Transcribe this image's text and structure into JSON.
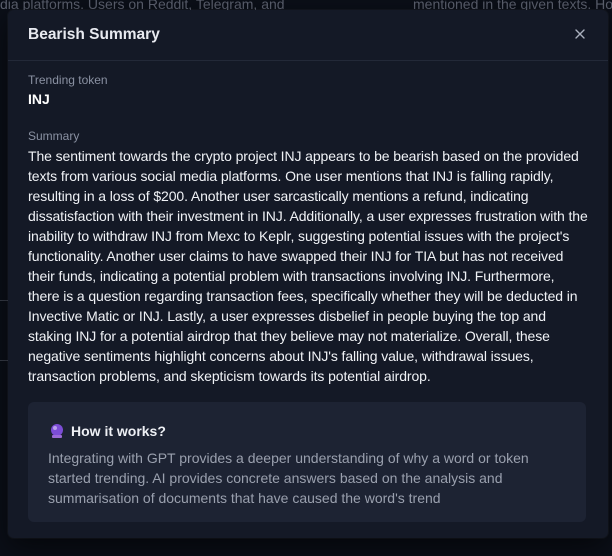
{
  "background": {
    "left_fragment": "dia platforms. Users on Reddit, Telegram, and",
    "right_fragment": "mentioned in the given texts. Ho"
  },
  "modal": {
    "title": "Bearish Summary",
    "close_icon": "close-icon",
    "token_label": "Trending token",
    "token_value": "INJ",
    "summary_label": "Summary",
    "summary_text": "The sentiment towards the crypto project INJ appears to be bearish based on the provided texts from various social media platforms. One user mentions that INJ is falling rapidly, resulting in a loss of $200. Another user sarcastically mentions a refund, indicating dissatisfaction with their investment in INJ. Additionally, a user expresses frustration with the inability to withdraw INJ from Mexc to Keplr, suggesting potential issues with the project's functionality. Another user claims to have swapped their INJ for TIA but has not received their funds, indicating a potential problem with transactions involving INJ. Furthermore, there is a question regarding transaction fees, specifically whether they will be deducted in Invective Matic or INJ. Lastly, a user expresses disbelief in people buying the top and staking INJ for a potential airdrop that they believe may not materialize. Overall, these negative sentiments highlight concerns about INJ's falling value, withdrawal issues, transaction problems, and skepticism towards its potential airdrop."
  },
  "info": {
    "icon": "crystal-ball-icon",
    "title": "How it works?",
    "text": "Integrating with GPT provides a deeper understanding of why a word or token started trending. AI provides concrete answers based on the analysis and summarisation of documents that have caused the word's trend"
  },
  "colors": {
    "modal_bg": "#141926",
    "info_bg": "#1d2333",
    "accent_purple": "#8b5cf6"
  }
}
